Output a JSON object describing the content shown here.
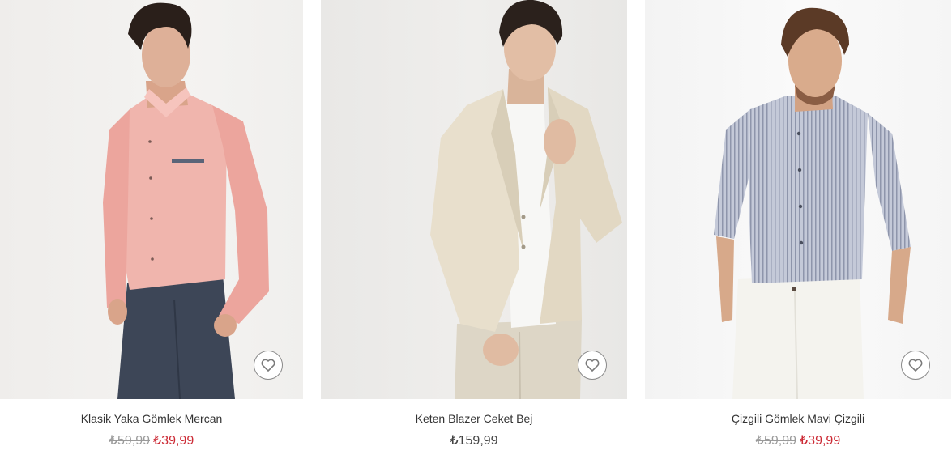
{
  "products": [
    {
      "name": "Klasik Yaka Gömlek Mercan",
      "old_price": "₺59,99",
      "price": "₺39,99",
      "favorite_icon": "heart-outline-icon"
    },
    {
      "name": "Keten Blazer Ceket Bej",
      "price": "₺159,99",
      "favorite_icon": "heart-outline-icon"
    },
    {
      "name": "Çizgili Gömlek Mavi Çizgili",
      "old_price": "₺59,99",
      "price": "₺39,99",
      "favorite_icon": "heart-outline-icon"
    }
  ],
  "colors": {
    "sale_price": "#cc2a35",
    "old_price": "#9a9a9a",
    "text": "#333333"
  }
}
